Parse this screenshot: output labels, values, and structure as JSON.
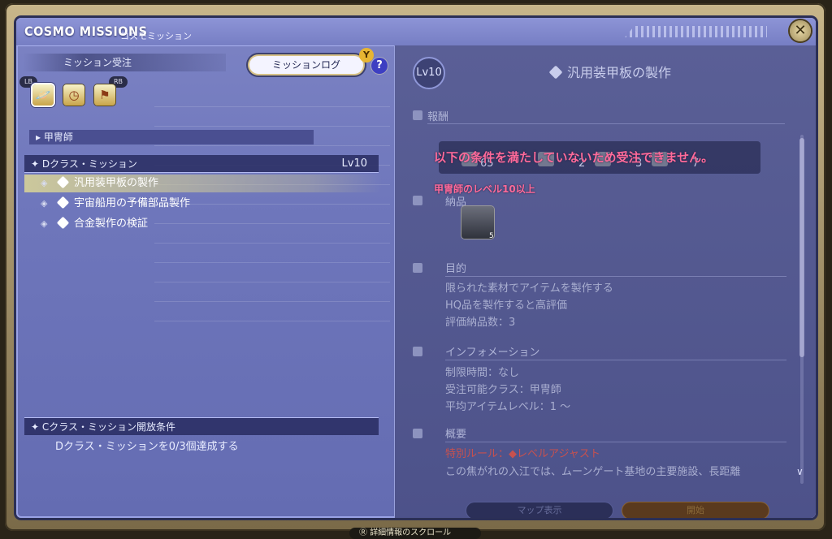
{
  "window": {
    "title": "COSMO MISSIONS",
    "subtitle": "コスモミッション",
    "close_icon": "close-icon"
  },
  "left": {
    "tab_label": "ミッション受注",
    "mission_log_label": "ミッションログ",
    "y_button": "Y",
    "help": "?",
    "lb": "LB",
    "rb": "RB",
    "job": "甲冑師",
    "rank_header": "Dクラス・ミッション",
    "rank_level": "Lv10",
    "missions": [
      {
        "name": "汎用装甲板の製作",
        "selected": true
      },
      {
        "name": "宇宙船用の予備部品製作",
        "selected": false
      },
      {
        "name": "合金製作の検証",
        "selected": false
      }
    ],
    "unlock_header": "Cクラス・ミッション開放条件",
    "unlock_text": "Dクラス・ミッションを0/3個達成する"
  },
  "right": {
    "level_badge": "Lv10",
    "mission_title": "汎用装甲板の製作",
    "rewards_head": "報酬",
    "reward_counts": [
      "65",
      "2",
      "3",
      "7"
    ],
    "error_main": "以下の条件を満たしていないため受注できません。",
    "error_sub": "甲冑師のレベル10以上",
    "deliver_head": "納品",
    "deliver_count": "5",
    "objective_head": "目的",
    "objectives": [
      "限られた素材でアイテムを製作する",
      "HQ品を製作すると高評価",
      "評価納品数：3"
    ],
    "info_head": "インフォメーション",
    "info": [
      "制限時間：なし",
      "受注可能クラス：甲冑師",
      "平均アイテムレベル：1 ～"
    ],
    "overview_head": "概要",
    "special_rule_label": "特別ルール：",
    "special_rule": "レベルアジャスト",
    "overview_text": "この焦がれの入江では、ムーンゲート基地の主要施設、長距離",
    "map_button": "マップ表示",
    "start_button": "開始"
  },
  "footer": {
    "hint": "詳細情報のスクロール"
  }
}
